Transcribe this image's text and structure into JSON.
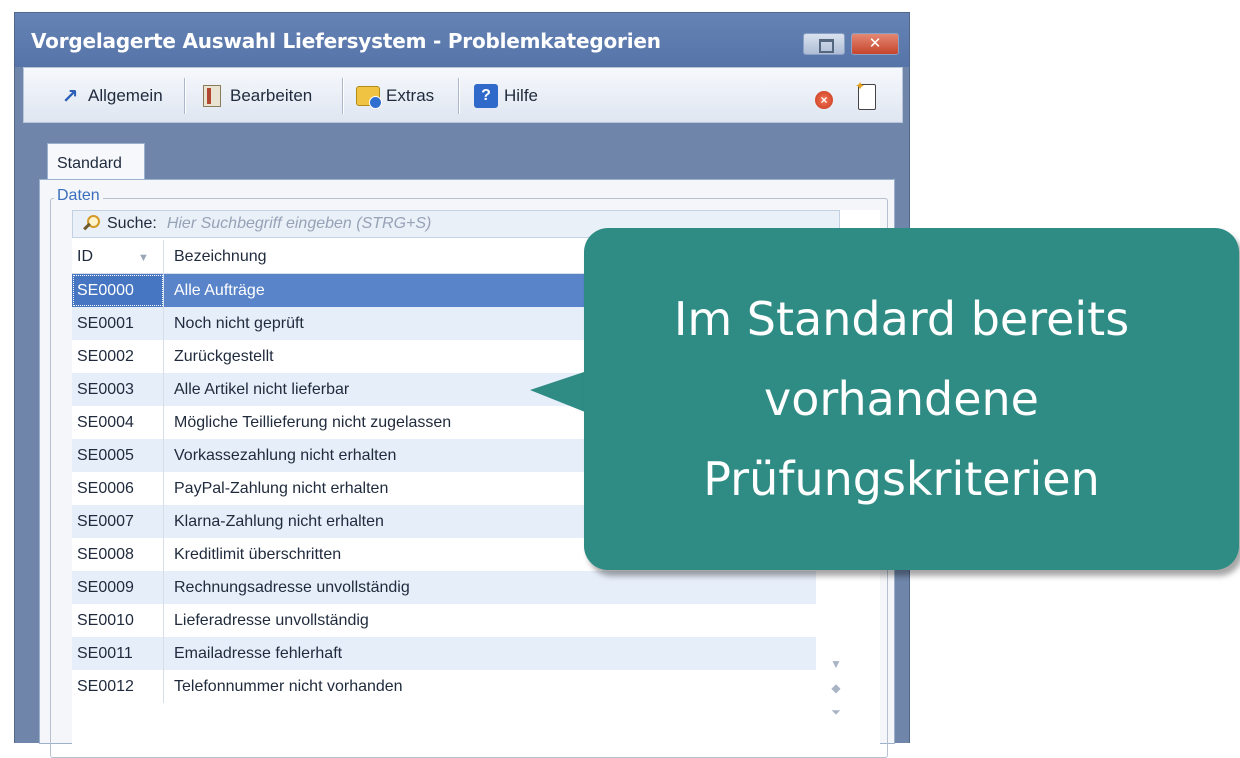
{
  "window": {
    "title": "Vorgelagerte Auswahl Liefersystem - Problemkategorien",
    "close_glyph": "✕"
  },
  "toolbar": {
    "items": [
      {
        "label": "Allgemein",
        "icon": "arrow-icon"
      },
      {
        "label": "Bearbeiten",
        "icon": "edit-icon"
      },
      {
        "label": "Extras",
        "icon": "extras-icon"
      },
      {
        "label": "Hilfe",
        "icon": "help-icon"
      }
    ],
    "help_glyph": "?",
    "stop_glyph": "×"
  },
  "tabs": [
    {
      "label": "Standard",
      "active": true
    }
  ],
  "group": {
    "label": "Daten"
  },
  "search": {
    "label": "Suche:",
    "placeholder": "Hier Suchbegriff eingeben (STRG+S)"
  },
  "grid": {
    "columns": [
      "ID",
      "Bezeichnung"
    ],
    "rows": [
      {
        "id": "SE0000",
        "name": "Alle Aufträge"
      },
      {
        "id": "SE0001",
        "name": "Noch nicht geprüft"
      },
      {
        "id": "SE0002",
        "name": "Zurückgestellt"
      },
      {
        "id": "SE0003",
        "name": "Alle Artikel nicht lieferbar"
      },
      {
        "id": "SE0004",
        "name": "Mögliche Teillieferung nicht zugelassen"
      },
      {
        "id": "SE0005",
        "name": "Vorkassezahlung nicht erhalten"
      },
      {
        "id": "SE0006",
        "name": "PayPal-Zahlung nicht erhalten"
      },
      {
        "id": "SE0007",
        "name": "Klarna-Zahlung nicht erhalten"
      },
      {
        "id": "SE0008",
        "name": "Kreditlimit überschritten"
      },
      {
        "id": "SE0009",
        "name": "Rechnungsadresse unvollständig"
      },
      {
        "id": "SE0010",
        "name": "Lieferadresse unvollständig"
      },
      {
        "id": "SE0011",
        "name": "Emailadresse fehlerhaft"
      },
      {
        "id": "SE0012",
        "name": "Telefonnummer nicht vorhanden"
      }
    ],
    "selected_index": 0
  },
  "callout": {
    "lines": [
      "Im Standard bereits",
      "vorhandene",
      "Prüfungskriterien"
    ],
    "color": "#2e8c84"
  }
}
